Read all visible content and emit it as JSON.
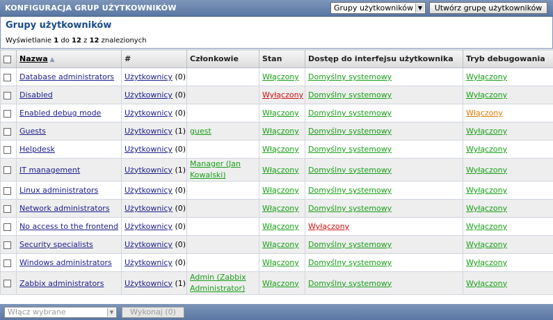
{
  "header": {
    "title": "KONFIGURACJA GRUP UŻYTKOWNIKÓW",
    "select_value": "Grupy użytkowników",
    "create_button": "Utwórz grupę użytkowników"
  },
  "panel": {
    "title": "Grupy użytkowników",
    "info_prefix": "Wyświetlanie ",
    "info_from": "1",
    "info_to_word": " do ",
    "info_to": "12",
    "info_of_word": " z ",
    "info_total": "12",
    "info_suffix": " znalezionych"
  },
  "table": {
    "columns": {
      "name": "Nazwa",
      "count": "#",
      "members": "Członkowie",
      "status": "Stan",
      "gui": "Dostęp do interfejsu użytkownika",
      "debug": "Tryb debugowania"
    },
    "rows": [
      {
        "name": "Database administrators",
        "users_label": "Użytkownicy",
        "users_count": "(0)",
        "members": "",
        "status": "Włączony",
        "gui": "Domyślny systemowy",
        "debug": "Wyłączony"
      },
      {
        "name": "Disabled",
        "users_label": "Użytkownicy",
        "users_count": "(0)",
        "members": "",
        "status": "Wyłączony",
        "gui": "Domyślny systemowy",
        "debug": "Wyłączony"
      },
      {
        "name": "Enabled debug mode",
        "users_label": "Użytkownicy",
        "users_count": "(0)",
        "members": "",
        "status": "Włączony",
        "gui": "Domyślny systemowy",
        "debug": "Włączony"
      },
      {
        "name": "Guests",
        "users_label": "Użytkownicy",
        "users_count": "(1)",
        "members": "guest",
        "status": "Włączony",
        "gui": "Domyślny systemowy",
        "debug": "Wyłączony"
      },
      {
        "name": "Helpdesk",
        "users_label": "Użytkownicy",
        "users_count": "(0)",
        "members": "",
        "status": "Włączony",
        "gui": "Domyślny systemowy",
        "debug": "Wyłączony"
      },
      {
        "name": "IT management",
        "users_label": "Użytkownicy",
        "users_count": "(1)",
        "members": "Manager (Jan Kowalski)",
        "status": "Włączony",
        "gui": "Domyślny systemowy",
        "debug": "Wyłączony"
      },
      {
        "name": "Linux administrators",
        "users_label": "Użytkownicy",
        "users_count": "(0)",
        "members": "",
        "status": "Włączony",
        "gui": "Domyślny systemowy",
        "debug": "Wyłączony"
      },
      {
        "name": "Network administrators",
        "users_label": "Użytkownicy",
        "users_count": "(0)",
        "members": "",
        "status": "Włączony",
        "gui": "Domyślny systemowy",
        "debug": "Wyłączony"
      },
      {
        "name": "No access to the frontend",
        "users_label": "Użytkownicy",
        "users_count": "(0)",
        "members": "",
        "status": "Włączony",
        "gui": "Wyłączony",
        "debug": "Wyłączony"
      },
      {
        "name": "Security specialists",
        "users_label": "Użytkownicy",
        "users_count": "(0)",
        "members": "",
        "status": "Włączony",
        "gui": "Domyślny systemowy",
        "debug": "Wyłączony"
      },
      {
        "name": "Windows administrators",
        "users_label": "Użytkownicy",
        "users_count": "(0)",
        "members": "",
        "status": "Włączony",
        "gui": "Domyślny systemowy",
        "debug": "Wyłączony"
      },
      {
        "name": "Zabbix administrators",
        "users_label": "Użytkownicy",
        "users_count": "(1)",
        "members": "Admin (Zabbix Administrator)",
        "status": "Włączony",
        "gui": "Domyślny systemowy",
        "debug": "Wyłączony"
      }
    ]
  },
  "footer": {
    "select_placeholder": "Włącz wybrane",
    "execute_button": "Wykonaj (0)"
  },
  "colors": {
    "header_bg": "#6b86af",
    "link_blue": "#1b1e8c",
    "enabled_green": "#18a018",
    "disabled_red": "#d11111",
    "debug_on_orange": "#e07a00"
  }
}
